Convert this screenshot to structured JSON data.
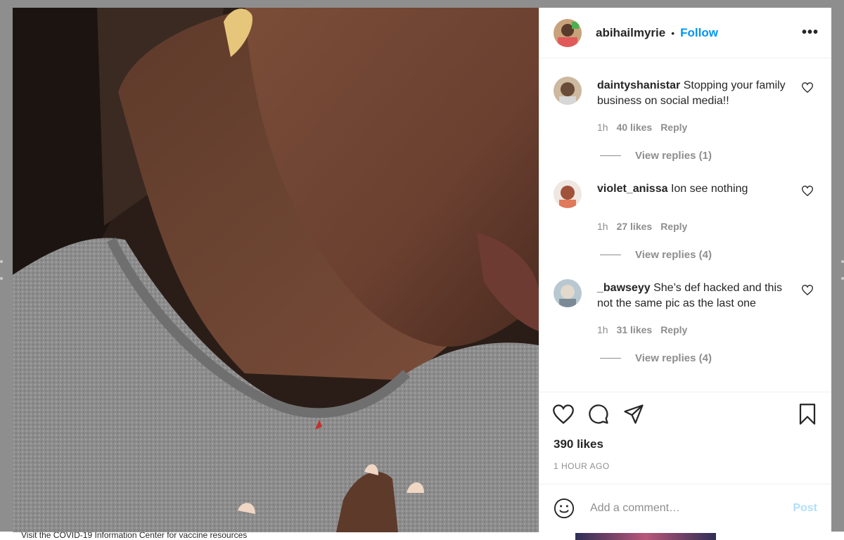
{
  "page": {
    "backdrop_note": "Visit the COVID-19 Information Center for vaccine resources"
  },
  "post": {
    "username": "abihailmyrie",
    "separator": "•",
    "follow_label": "Follow",
    "more_label": "•••",
    "likes": "390 likes",
    "time_ago": "1 HOUR AGO",
    "image_alt": "Close-up photo of a person's neck with a red mark, wearing a grey t-shirt"
  },
  "comments": [
    {
      "username": "daintyshanistar",
      "text": "Stopping your family business on social media!!",
      "time": "1h",
      "likes": "40 likes",
      "reply_label": "Reply",
      "view_replies": "View replies (1)"
    },
    {
      "username": "violet_anissa",
      "text": "Ion see nothing",
      "time": "1h",
      "likes": "27 likes",
      "reply_label": "Reply",
      "view_replies": "View replies (4)"
    },
    {
      "username": "_bawseyy",
      "text": "She’s def hacked and this not the same pic as the last one",
      "time": "1h",
      "likes": "31 likes",
      "reply_label": "Reply",
      "view_replies": "View replies (4)"
    }
  ],
  "composer": {
    "placeholder": "Add a comment…",
    "post_label": "Post"
  },
  "icons": {
    "like": "heart-icon",
    "comment": "comment-bubble-icon",
    "share": "paper-plane-icon",
    "save": "bookmark-icon",
    "emoji": "smiley-icon",
    "more": "ellipsis-icon"
  }
}
